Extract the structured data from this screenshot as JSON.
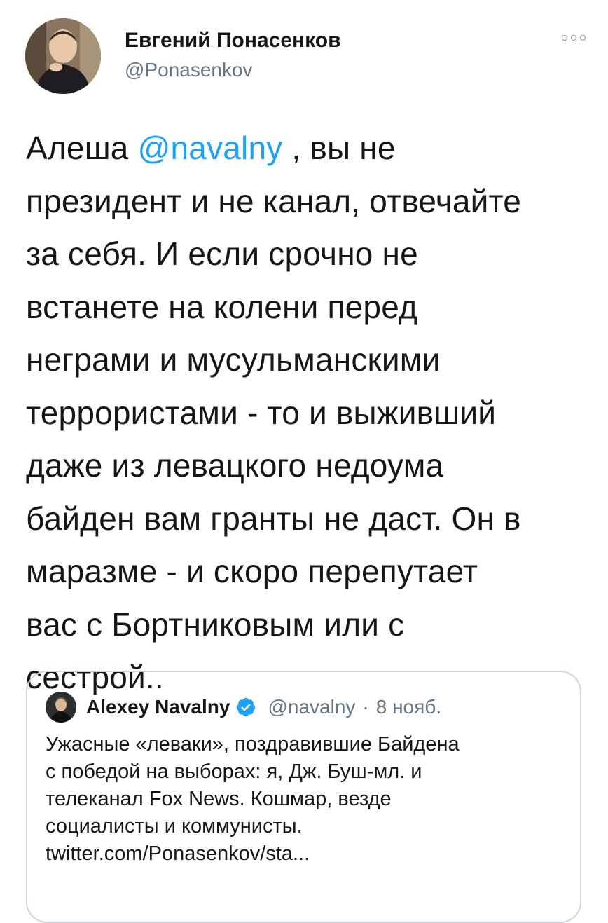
{
  "tweet": {
    "author": {
      "display_name": "Евгений Понасенков",
      "handle": "@Ponasenkov"
    },
    "text": {
      "line1_before": "Алеша ",
      "line1_mention": "@navalny",
      "line1_after": " , вы не",
      "lines": [
        "президент и не канал, отвечайте",
        "за себя. И если срочно не",
        "встанете на колени перед",
        "неграми и мусульманскими",
        "террористами - то и выживший",
        "даже из левацкого недоума",
        "байден вам гранты не даст. Он в",
        "маразме - и скоро перепутает",
        "вас с Бортниковым или с",
        "сестрой.."
      ]
    },
    "more_icon": "more-options-icon"
  },
  "quoted_tweet": {
    "author": {
      "display_name": "Alexey Navalny",
      "handle": "@navalny",
      "verified_icon": "verified-badge-icon"
    },
    "separator": "·",
    "date": "8 нояб.",
    "text_lines": [
      "Ужасные «леваки», поздравившие Байдена",
      "с победой на выборах: я, Дж. Буш-мл. и",
      "телеканал Fox News. Кошмар, везде",
      "социалисты и коммунисты.",
      "twitter.com/Ponasenkov/sta..."
    ]
  },
  "colors": {
    "accent": "#1da1f2",
    "text": "#14171a",
    "secondary_text": "#657786",
    "border": "#ccd6dd"
  }
}
